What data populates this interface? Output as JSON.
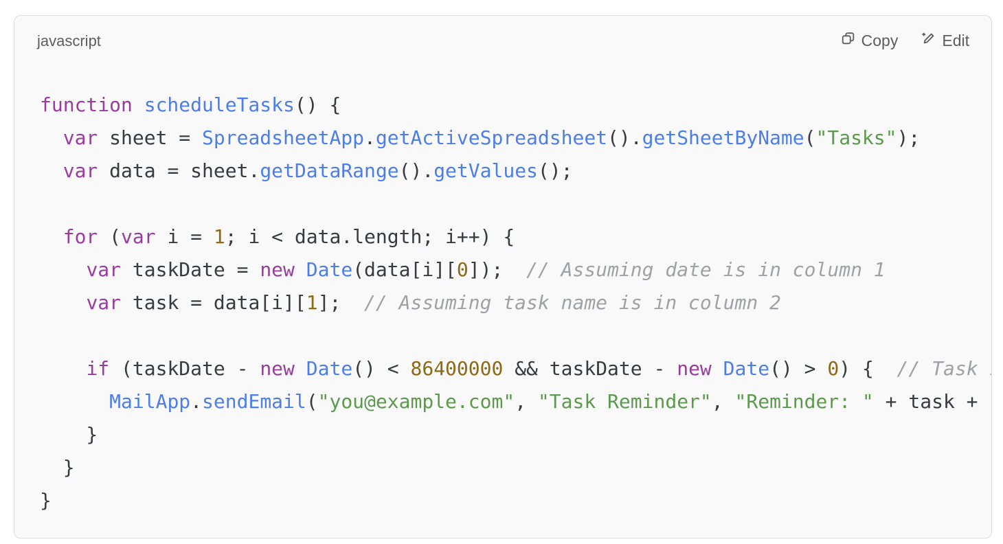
{
  "header": {
    "language": "javascript",
    "copy_label": "Copy",
    "copy_icon": "copy-icon",
    "edit_label": "Edit",
    "edit_icon": "pencil-sparkle-icon"
  },
  "colors": {
    "keyword": "#9b3b9f",
    "function": "#4d7ee8",
    "string": "#5b9a4b",
    "number": "#8c6a14",
    "comment": "#a0a1a7",
    "plain": "#383a42"
  },
  "code": {
    "lines": [
      [
        {
          "t": "kw",
          "text": "function"
        },
        {
          "t": "pl",
          "text": " "
        },
        {
          "t": "fn",
          "text": "scheduleTasks"
        },
        {
          "t": "pl",
          "text": "() {"
        }
      ],
      [
        {
          "t": "pl",
          "text": "  "
        },
        {
          "t": "kw",
          "text": "var"
        },
        {
          "t": "pl",
          "text": " sheet = "
        },
        {
          "t": "fn",
          "text": "SpreadsheetApp"
        },
        {
          "t": "pl",
          "text": "."
        },
        {
          "t": "fn",
          "text": "getActiveSpreadsheet"
        },
        {
          "t": "pl",
          "text": "()."
        },
        {
          "t": "fn",
          "text": "getSheetByName"
        },
        {
          "t": "pl",
          "text": "("
        },
        {
          "t": "str",
          "text": "\"Tasks\""
        },
        {
          "t": "pl",
          "text": ");"
        }
      ],
      [
        {
          "t": "pl",
          "text": "  "
        },
        {
          "t": "kw",
          "text": "var"
        },
        {
          "t": "pl",
          "text": " data = sheet."
        },
        {
          "t": "fn",
          "text": "getDataRange"
        },
        {
          "t": "pl",
          "text": "()."
        },
        {
          "t": "fn",
          "text": "getValues"
        },
        {
          "t": "pl",
          "text": "();"
        }
      ],
      [],
      [
        {
          "t": "pl",
          "text": "  "
        },
        {
          "t": "kw",
          "text": "for"
        },
        {
          "t": "pl",
          "text": " ("
        },
        {
          "t": "kw",
          "text": "var"
        },
        {
          "t": "pl",
          "text": " i = "
        },
        {
          "t": "num",
          "text": "1"
        },
        {
          "t": "pl",
          "text": "; i < data.length; i++) {"
        }
      ],
      [
        {
          "t": "pl",
          "text": "    "
        },
        {
          "t": "kw",
          "text": "var"
        },
        {
          "t": "pl",
          "text": " taskDate = "
        },
        {
          "t": "kw",
          "text": "new"
        },
        {
          "t": "pl",
          "text": " "
        },
        {
          "t": "fn",
          "text": "Date"
        },
        {
          "t": "pl",
          "text": "(data[i]["
        },
        {
          "t": "num",
          "text": "0"
        },
        {
          "t": "pl",
          "text": "]);  "
        },
        {
          "t": "cm",
          "text": "// Assuming date is in column 1"
        }
      ],
      [
        {
          "t": "pl",
          "text": "    "
        },
        {
          "t": "kw",
          "text": "var"
        },
        {
          "t": "pl",
          "text": " task = data[i]["
        },
        {
          "t": "num",
          "text": "1"
        },
        {
          "t": "pl",
          "text": "];  "
        },
        {
          "t": "cm",
          "text": "// Assuming task name is in column 2"
        }
      ],
      [],
      [
        {
          "t": "pl",
          "text": "    "
        },
        {
          "t": "kw",
          "text": "if"
        },
        {
          "t": "pl",
          "text": " (taskDate - "
        },
        {
          "t": "kw",
          "text": "new"
        },
        {
          "t": "pl",
          "text": " "
        },
        {
          "t": "fn",
          "text": "Date"
        },
        {
          "t": "pl",
          "text": "() < "
        },
        {
          "t": "num",
          "text": "86400000"
        },
        {
          "t": "pl",
          "text": " && taskDate - "
        },
        {
          "t": "kw",
          "text": "new"
        },
        {
          "t": "pl",
          "text": " "
        },
        {
          "t": "fn",
          "text": "Date"
        },
        {
          "t": "pl",
          "text": "() > "
        },
        {
          "t": "num",
          "text": "0"
        },
        {
          "t": "pl",
          "text": ") {  "
        },
        {
          "t": "cm",
          "text": "// Task i"
        }
      ],
      [
        {
          "t": "pl",
          "text": "      "
        },
        {
          "t": "fn",
          "text": "MailApp"
        },
        {
          "t": "pl",
          "text": "."
        },
        {
          "t": "fn",
          "text": "sendEmail"
        },
        {
          "t": "pl",
          "text": "("
        },
        {
          "t": "str",
          "text": "\"you@example.com\""
        },
        {
          "t": "pl",
          "text": ", "
        },
        {
          "t": "str",
          "text": "\"Task Reminder\""
        },
        {
          "t": "pl",
          "text": ", "
        },
        {
          "t": "str",
          "text": "\"Reminder: \""
        },
        {
          "t": "pl",
          "text": " + task + "
        },
        {
          "t": "str",
          "text": "\""
        }
      ],
      [
        {
          "t": "pl",
          "text": "    }"
        }
      ],
      [
        {
          "t": "pl",
          "text": "  }"
        }
      ],
      [
        {
          "t": "pl",
          "text": "}"
        }
      ]
    ]
  }
}
